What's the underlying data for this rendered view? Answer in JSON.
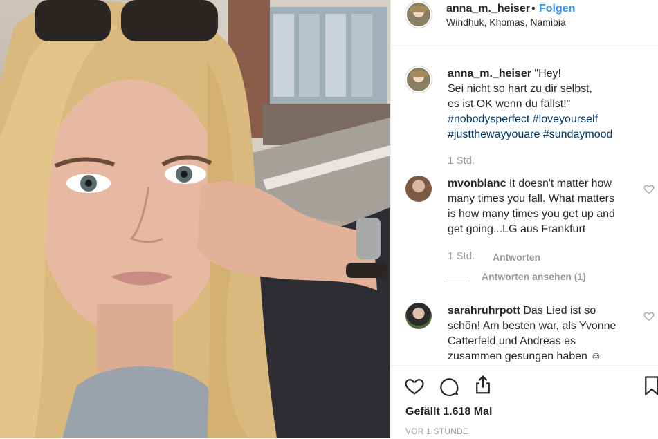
{
  "post": {
    "author": "anna_m._heiser",
    "separator": "•",
    "follow_label": "Folgen",
    "location": "Windhuk, Khomas, Namibia"
  },
  "caption": {
    "user": "anna_m._heiser",
    "lines": [
      "\"Hey!",
      "Sei nicht so hart zu dir selbst,",
      "es ist OK wenn du fällst!\""
    ],
    "hashtags_line1": [
      "#nobodysperfect",
      "#loveyourself"
    ],
    "hashtags_line2": [
      "#justthewayyouare",
      "#sundaymood"
    ],
    "time": "1 Std."
  },
  "comments": [
    {
      "user": "mvonblanc",
      "lines": [
        "It doesn't matter how",
        "many times you fall. What matters",
        "is how many times you get up and",
        "get going...LG aus Frankfurt"
      ],
      "time": "1 Std.",
      "reply_label": "Antworten",
      "view_replies_label": "Antworten ansehen (1)"
    },
    {
      "user": "sarahruhrpott",
      "lines": [
        "Das Lied ist so",
        "schön! Am besten war, als Yvonne",
        "Catterfeld und Andreas es",
        "zusammen gesungen haben ☺"
      ]
    }
  ],
  "actions": {
    "likes_text": "Gefällt 1.618 Mal",
    "posted_ago": "VOR 1 STUNDE"
  },
  "icons": {
    "like": "heart-icon",
    "comment": "comment-icon",
    "share": "share-icon",
    "save": "bookmark-icon",
    "comment_like": "small-heart-icon"
  },
  "colors": {
    "link_blue": "#3897f0",
    "hashtag": "#003569",
    "muted": "#999999",
    "text": "#262626"
  }
}
